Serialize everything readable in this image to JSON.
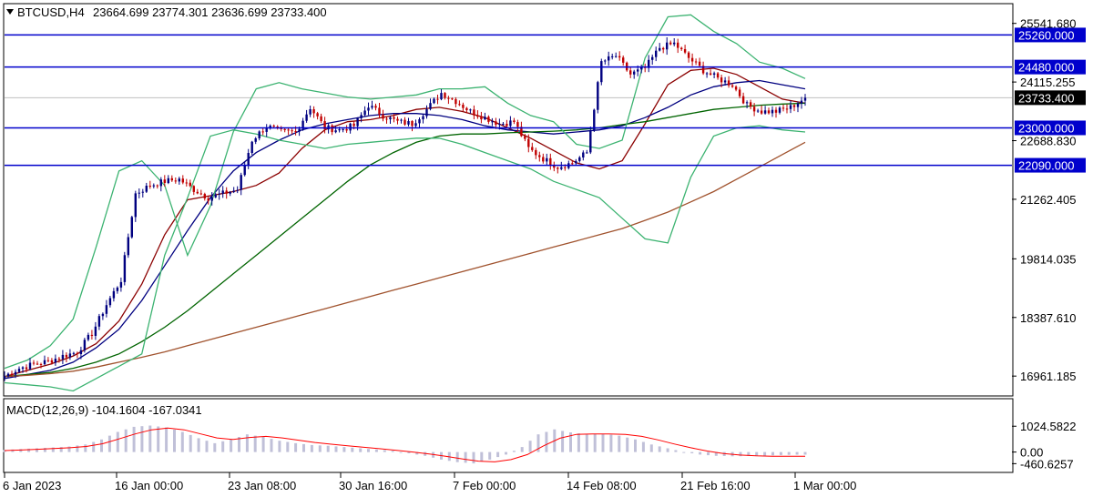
{
  "window": {
    "symbol": "BTCUSD,H4",
    "ohlc": "23664.699 23774.301 23636.699 23733.400"
  },
  "chart_data": [
    {
      "type": "candlestick",
      "title": "BTCUSD,H4 23664.699 23774.301 23636.699 23733.400",
      "ylim": [
        16500,
        26000
      ],
      "y_ticks": [
        {
          "value": 25541.68,
          "label": "25541.680"
        },
        {
          "value": 24115.255,
          "label": "24115.255"
        },
        {
          "value": 22688.83,
          "label": "22688.830"
        },
        {
          "value": 21262.405,
          "label": "21262.405"
        },
        {
          "value": 19814.035,
          "label": "19814.035"
        },
        {
          "value": 18387.61,
          "label": "18387.610"
        },
        {
          "value": 16961.185,
          "label": "16961.185"
        }
      ],
      "x_ticks": [
        "6 Jan 2023",
        "16 Jan 00:00",
        "23 Jan 08:00",
        "30 Jan 16:00",
        "7 Feb 00:00",
        "14 Feb 08:00",
        "21 Feb 16:00",
        "1 Mar 00:00"
      ],
      "horizontal_levels": [
        {
          "value": 25260.0,
          "label": "25260.000",
          "color": "#0000cc"
        },
        {
          "value": 24480.0,
          "label": "24480.000",
          "color": "#0000cc"
        },
        {
          "value": 23000.0,
          "label": "23000.000",
          "color": "#0000cc"
        },
        {
          "value": 22090.0,
          "label": "22090.000",
          "color": "#0000cc"
        }
      ],
      "current_price": {
        "value": 23733.4,
        "label": "23733.400"
      },
      "price_path": [
        16960,
        17150,
        17250,
        17320,
        17450,
        17550,
        18000,
        18700,
        19300,
        21400,
        21600,
        21700,
        21750,
        21500,
        21300,
        21400,
        21500,
        22700,
        23050,
        22900,
        22900,
        23500,
        23000,
        22950,
        23050,
        23550,
        23300,
        23150,
        23100,
        23450,
        23850,
        23650,
        23400,
        23250,
        23100,
        23150,
        22500,
        22250,
        22050,
        22150,
        22400,
        24600,
        24750,
        24300,
        24450,
        24950,
        25050,
        24700,
        24400,
        24200,
        24050,
        23550,
        23400,
        23400,
        23500,
        23733
      ],
      "series": [
        {
          "name": "",
          "color": "#8b0000",
          "values": [
            16950,
            17100,
            17250,
            17450,
            17750,
            18300,
            19200,
            20400,
            21250,
            21350,
            21450,
            21600,
            21900,
            22500,
            22950,
            23150,
            23200,
            23300,
            23450,
            23500,
            23400,
            23250,
            23000,
            22750,
            22450,
            22150,
            22000,
            22200,
            23100,
            24050,
            24400,
            24450,
            24300,
            24000,
            23700,
            23600
          ]
        },
        {
          "name": "",
          "color": "#000080",
          "values": [
            16900,
            17000,
            17100,
            17300,
            17650,
            18100,
            18800,
            19650,
            20500,
            21300,
            21950,
            22400,
            22700,
            22950,
            23100,
            23200,
            23300,
            23350,
            23350,
            23300,
            23200,
            23050,
            22950,
            22900,
            22850,
            22900,
            22950,
            23050,
            23250,
            23500,
            23800,
            24000,
            24100,
            24150,
            24050,
            23950
          ]
        },
        {
          "name": "",
          "color": "#006400",
          "values": [
            16950,
            17000,
            17050,
            17150,
            17300,
            17500,
            17800,
            18150,
            18550,
            19000,
            19450,
            19900,
            20350,
            20800,
            21250,
            21700,
            22100,
            22400,
            22650,
            22800,
            22850,
            22850,
            22880,
            22900,
            22920,
            22950,
            23000,
            23080,
            23150,
            23250,
            23350,
            23450,
            23500,
            23550,
            23580,
            23600
          ]
        },
        {
          "name": "",
          "color": "#a0522d",
          "values": [
            16950,
            16980,
            17020,
            17080,
            17180,
            17300,
            17420,
            17550,
            17700,
            17850,
            18000,
            18150,
            18300,
            18450,
            18600,
            18750,
            18900,
            19050,
            19200,
            19350,
            19500,
            19650,
            19800,
            19950,
            20100,
            20250,
            20400,
            20550,
            20750,
            20950,
            21200,
            21450,
            21750,
            22050,
            22350,
            22650
          ]
        },
        {
          "name": "",
          "color": "#3cb371",
          "values": [
            17150,
            17350,
            17700,
            18350,
            20100,
            21950,
            22200,
            21600,
            19900,
            21100,
            22900,
            23950,
            24100,
            23950,
            23850,
            23750,
            23700,
            23750,
            23800,
            23950,
            23950,
            24000,
            23600,
            23300,
            23150,
            22600,
            22500,
            22700,
            24700,
            25700,
            25750,
            25350,
            25050,
            24600,
            24450,
            24200
          ]
        },
        {
          "name": "",
          "color": "#3cb371",
          "values": [
            16800,
            16750,
            16700,
            16600,
            16900,
            17200,
            17500,
            19900,
            21300,
            22800,
            22950,
            22850,
            22700,
            22600,
            22500,
            22600,
            22650,
            22700,
            22750,
            22750,
            22600,
            22400,
            22200,
            22000,
            21700,
            21500,
            21300,
            20800,
            20300,
            20200,
            21800,
            22800,
            23000,
            23050,
            22950,
            22900
          ]
        }
      ]
    },
    {
      "type": "bar",
      "title": "MACD(12,26,9) -104.1604 -167.0341",
      "ylim": [
        -700,
        1250
      ],
      "y_ticks": [
        {
          "value": 1024.5822,
          "label": "1024.5822"
        },
        {
          "value": 0.0,
          "label": "0.00"
        },
        {
          "value": -460.6257,
          "label": "-460.6257"
        }
      ],
      "series": [
        {
          "name": "",
          "color": "#c0c0d8",
          "values": [
            80,
            120,
            150,
            180,
            220,
            300,
            500,
            800,
            1000,
            1050,
            980,
            800,
            550,
            350,
            500,
            700,
            600,
            450,
            350,
            280,
            250,
            200,
            150,
            100,
            50,
            -50,
            -150,
            -300,
            -400,
            -450,
            -300,
            -100,
            200,
            700,
            900,
            780,
            700,
            720,
            650,
            500,
            300,
            150,
            0,
            -100,
            -150,
            -170,
            -160,
            -140,
            -120,
            -104
          ]
        },
        {
          "name": "",
          "color": "#ff0000",
          "values": [
            60,
            80,
            110,
            140,
            170,
            220,
            330,
            520,
            720,
            880,
            950,
            880,
            720,
            560,
            500,
            580,
            620,
            560,
            470,
            380,
            310,
            250,
            190,
            130,
            70,
            0,
            -80,
            -170,
            -270,
            -360,
            -390,
            -300,
            -100,
            250,
            550,
            700,
            720,
            720,
            700,
            620,
            480,
            320,
            170,
            40,
            -60,
            -120,
            -150,
            -165,
            -168,
            -167
          ]
        }
      ]
    }
  ],
  "colors": {
    "bull_candle": "#000080",
    "bear_candle": "#c00000",
    "level_line": "#0000cc",
    "level_label_bg": "#0000cc",
    "current_price_bg": "#000000",
    "grid_border": "#000000"
  }
}
